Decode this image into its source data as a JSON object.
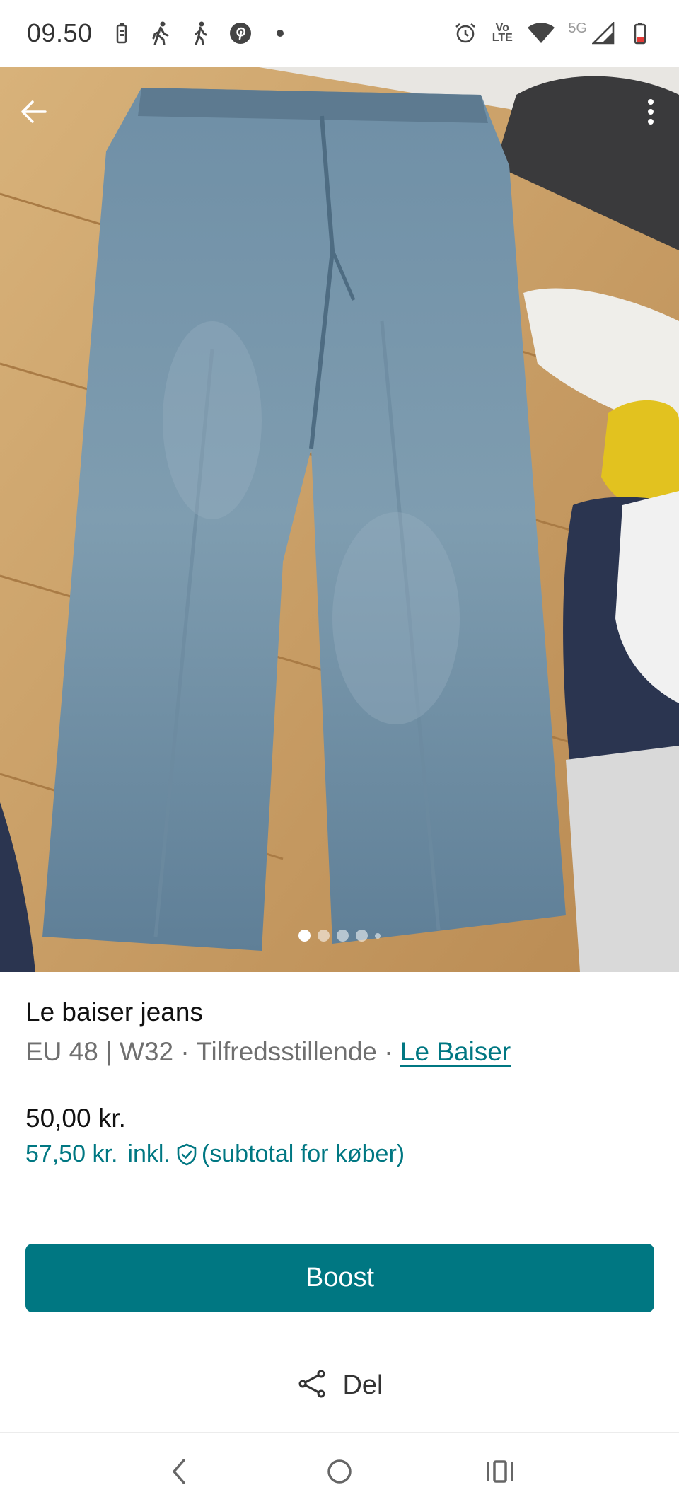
{
  "status_bar": {
    "time": "09.50",
    "volte_label_top": "Vo",
    "volte_label_bottom": "LTE",
    "network_label": "5G",
    "left_icons": [
      "battery-saver-icon",
      "walking-icon",
      "walking-icon",
      "pinterest-icon",
      "dot-icon"
    ],
    "right_icons": [
      "alarm-icon",
      "volte-icon",
      "wifi-icon",
      "signal-icon",
      "battery-low-icon"
    ]
  },
  "photo": {
    "current_photo": 1,
    "photo_count": 5,
    "back_icon": "arrow-left-icon",
    "more_icon": "more-vert-icon"
  },
  "listing": {
    "title": "Le baiser jeans",
    "size": "EU 48 | W32",
    "separator": " · ",
    "condition": "Tilfredsstillende",
    "brand": "Le Baiser",
    "price": "50,00 kr.",
    "price_incl_amount": "57,50 kr.",
    "price_incl_label": "inkl.",
    "price_incl_note": "(subtotal for køber)"
  },
  "actions": {
    "boost_label": "Boost",
    "share_label": "Del"
  },
  "colors": {
    "accent": "#007782"
  },
  "system_nav": [
    "back-icon",
    "home-icon",
    "recents-icon"
  ]
}
